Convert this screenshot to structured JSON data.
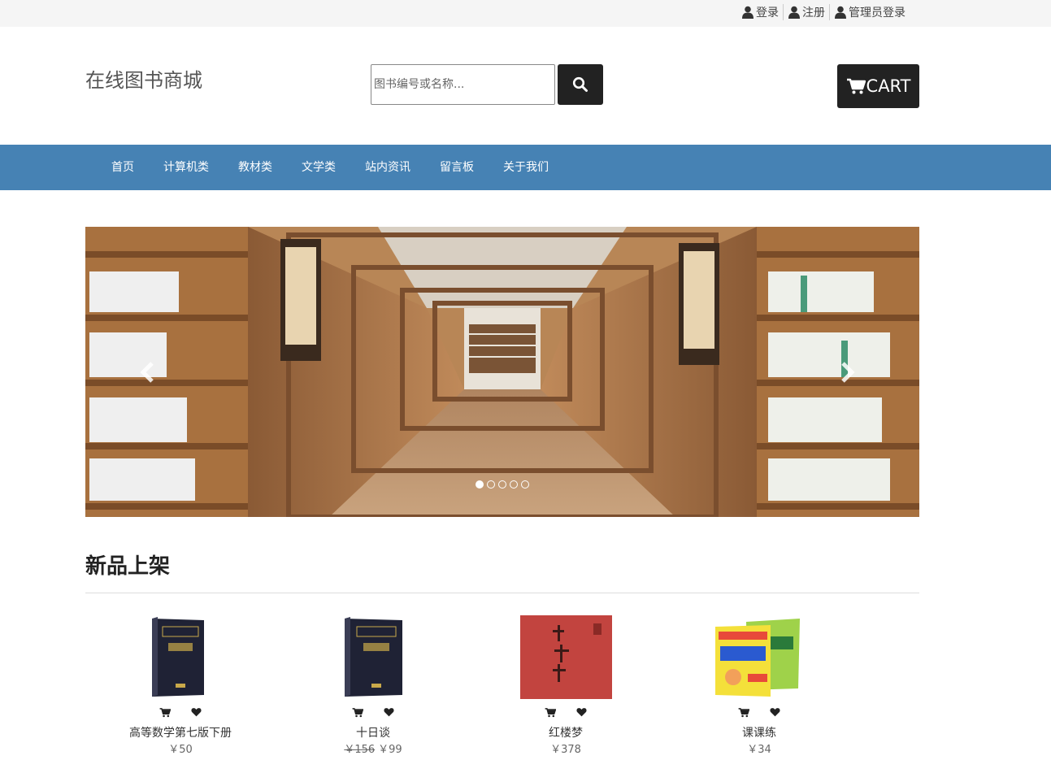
{
  "topbar": {
    "links": [
      {
        "label": "登录",
        "icon": "user-icon"
      },
      {
        "label": "注册",
        "icon": "user-icon"
      },
      {
        "label": "管理员登录",
        "icon": "user-icon"
      }
    ]
  },
  "header": {
    "brand": "在线图书商城",
    "search_placeholder": "图书编号或名称...",
    "search_icon": "search-icon",
    "cart_label": "CART",
    "cart_icon": "cart-icon"
  },
  "nav": {
    "items": [
      "首页",
      "计算机类",
      "教材类",
      "文学类",
      "站内资讯",
      "留言板",
      "关于我们"
    ]
  },
  "carousel": {
    "slide_count": 5,
    "active_index": 0,
    "prev_icon": "chevron-left-icon",
    "next_icon": "chevron-right-icon"
  },
  "section": {
    "title": "新品上架"
  },
  "products": [
    {
      "name": "高等数学第七版下册",
      "price": "￥50",
      "old_price": ""
    },
    {
      "name": "十日谈",
      "price": "￥99",
      "old_price": "￥156"
    },
    {
      "name": "红楼梦",
      "price": "￥378",
      "old_price": ""
    },
    {
      "name": "课课练",
      "price": "￥34",
      "old_price": ""
    }
  ],
  "colors": {
    "nav_bg": "#4682b4",
    "button_dark": "#222222",
    "topbar_bg": "#f5f5f5"
  }
}
